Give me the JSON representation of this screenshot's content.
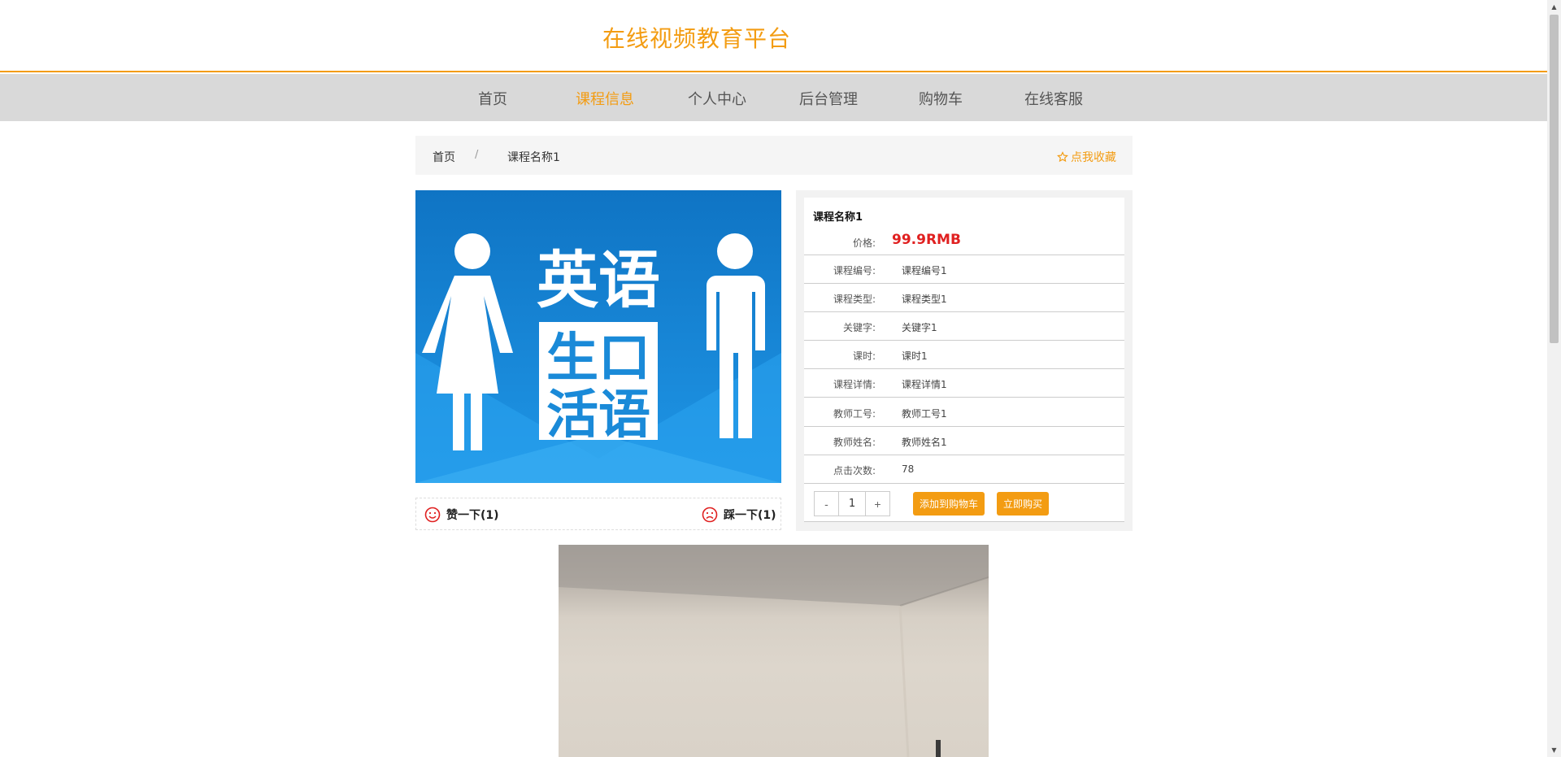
{
  "header": {
    "site_title": "在线视频教育平台"
  },
  "nav": {
    "items": [
      {
        "label": "首页"
      },
      {
        "label": "课程信息",
        "active": true
      },
      {
        "label": "个人中心"
      },
      {
        "label": "后台管理"
      },
      {
        "label": "购物车"
      },
      {
        "label": "在线客服"
      }
    ]
  },
  "breadcrumb": {
    "home": "首页",
    "separator": "/",
    "current": "课程名称1",
    "favorite": "点我收藏",
    "favorite_icon": "star-outline-icon"
  },
  "course": {
    "image_text": [
      "英语",
      "生口",
      "活语"
    ],
    "name": "课程名称1",
    "price_label": "价格:",
    "price": "99.9RMB",
    "fields": [
      {
        "label": "课程编号:",
        "value": "课程编号1"
      },
      {
        "label": "课程类型:",
        "value": "课程类型1"
      },
      {
        "label": "关键字:",
        "value": "关键字1"
      },
      {
        "label": "课时:",
        "value": "课时1"
      },
      {
        "label": "课程详情:",
        "value": "课程详情1"
      },
      {
        "label": "教师工号:",
        "value": "教师工号1"
      },
      {
        "label": "教师姓名:",
        "value": "教师姓名1"
      },
      {
        "label": "点击次数:",
        "value": "78"
      }
    ]
  },
  "votes": {
    "like": "赞一下(1)",
    "dislike": "踩一下(1)",
    "like_icon": "smile-icon",
    "dislike_icon": "frown-icon"
  },
  "purchase": {
    "minus": "-",
    "quantity": "1",
    "plus": "+",
    "add_to_cart": "添加到购物车",
    "buy_now": "立即购买"
  },
  "colors": {
    "accent": "#f39c12",
    "price": "#e02020",
    "nav_bg": "#d9d9d9"
  }
}
